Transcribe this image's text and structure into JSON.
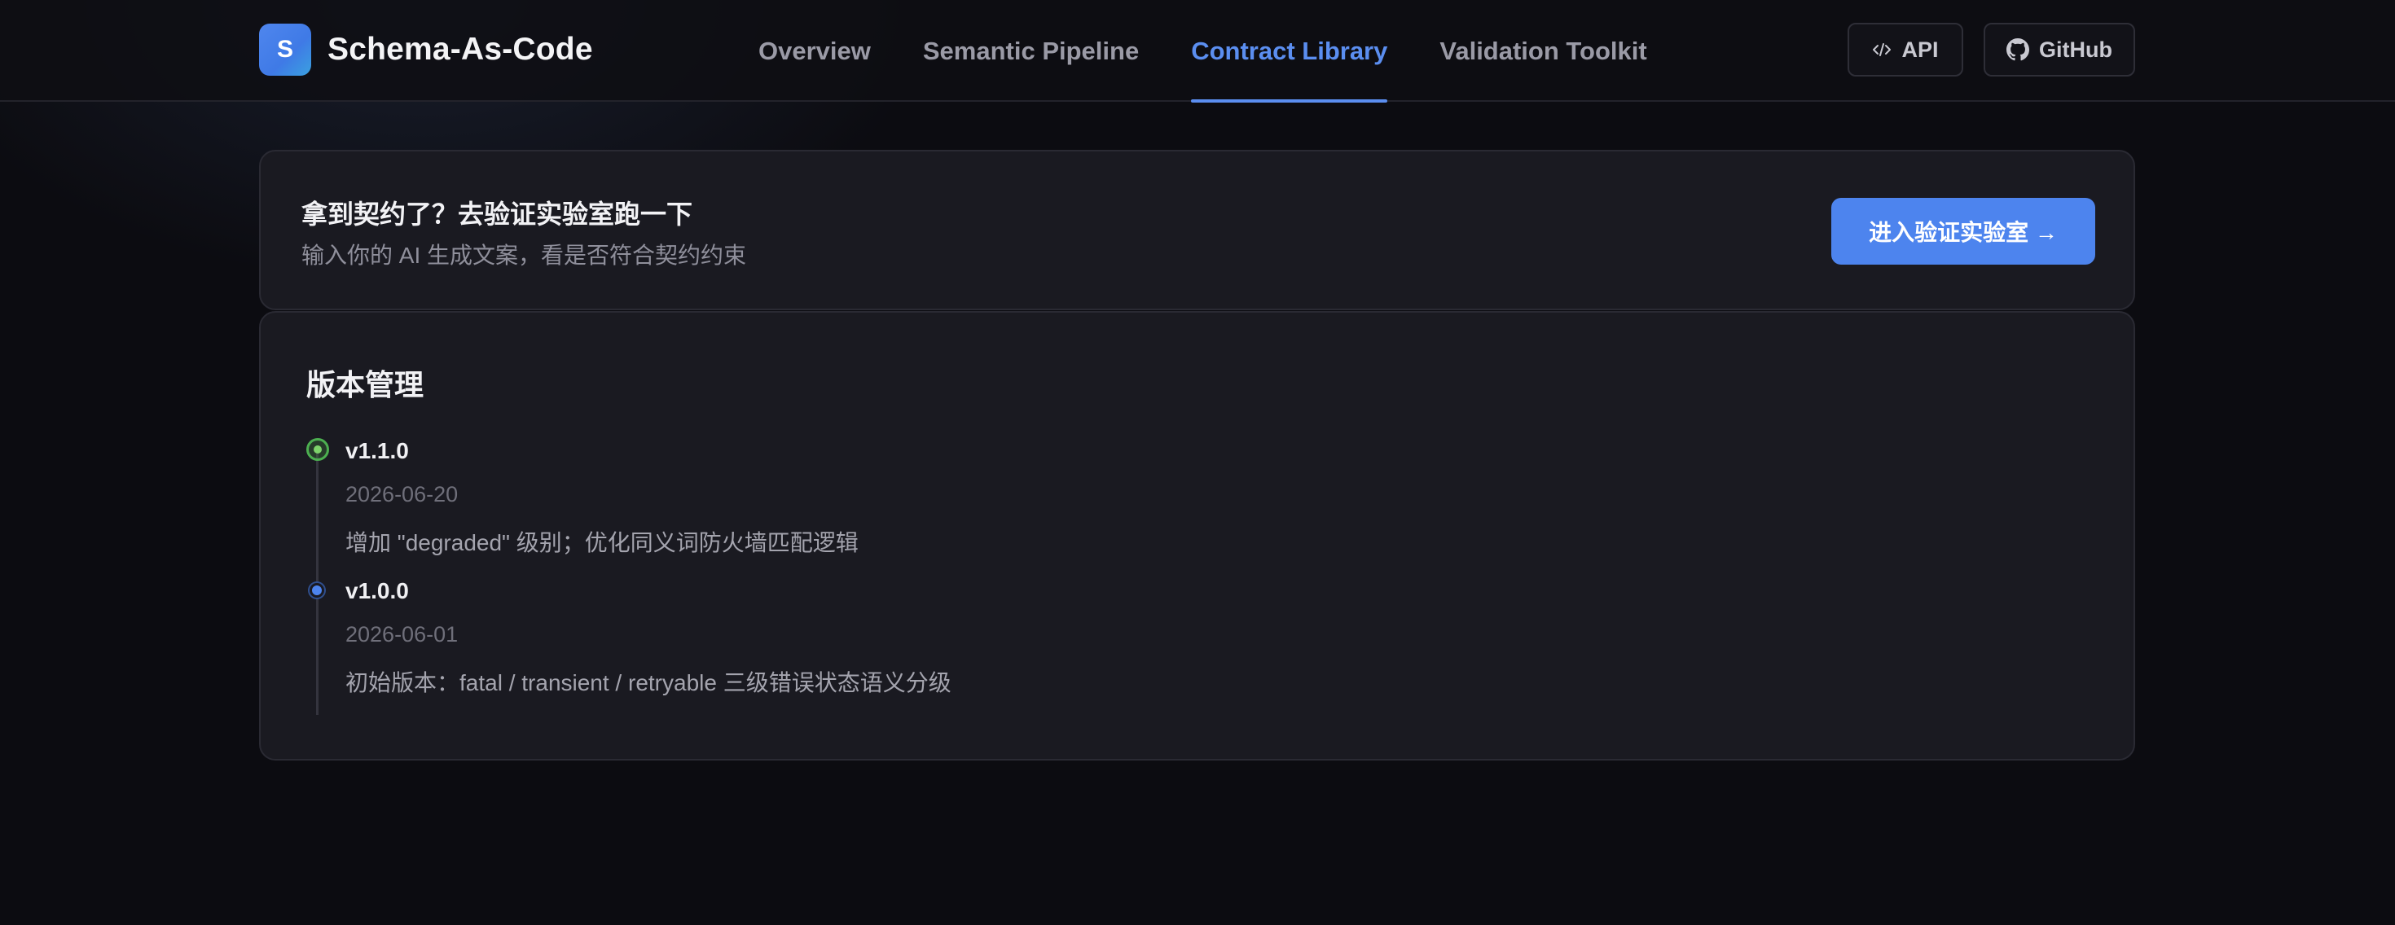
{
  "header": {
    "logo_letter": "S",
    "brand": "Schema-As-Code",
    "nav": [
      {
        "label": "Overview",
        "active": false
      },
      {
        "label": "Semantic Pipeline",
        "active": false
      },
      {
        "label": "Contract Library",
        "active": true
      },
      {
        "label": "Validation Toolkit",
        "active": false
      }
    ],
    "api_label": "API",
    "github_label": "GitHub",
    "accent_color": "#5b8ef0"
  },
  "banner": {
    "title": "拿到契约了？去验证实验室跑一下",
    "subtitle": "输入你的 AI 生成文案，看是否符合契约约束",
    "cta_label": "进入验证实验室 →"
  },
  "versions": {
    "title": "版本管理",
    "items": [
      {
        "version": "v1.1.0",
        "date": "2026-06-20",
        "description": "增加 \"degraded\" 级别；优化同义词防火墙匹配逻辑",
        "status_color": "#4caf50"
      },
      {
        "version": "v1.0.0",
        "date": "2026-06-01",
        "description": "初始版本：fatal / transient / retryable 三级错误状态语义分级",
        "status_color": "#4d84ee"
      }
    ]
  }
}
